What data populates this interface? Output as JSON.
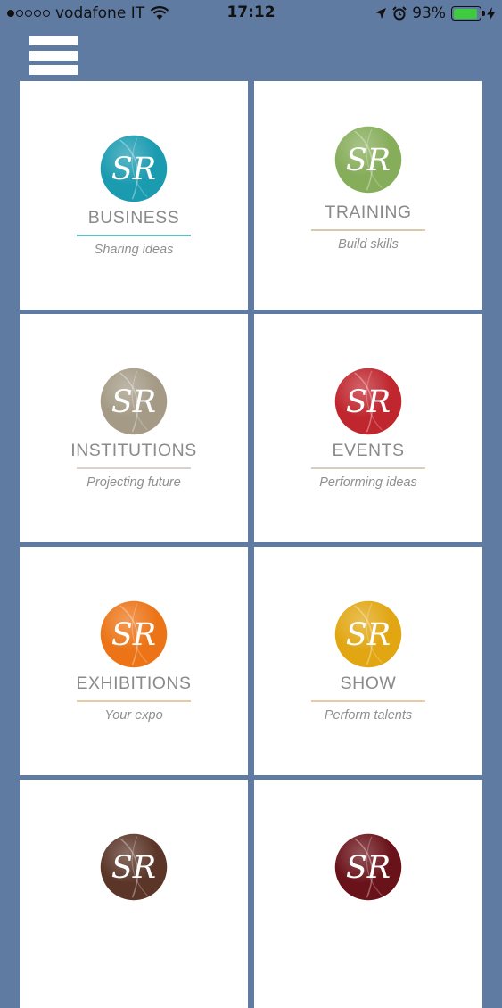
{
  "status": {
    "carrier": "vodafone IT",
    "time": "17:12",
    "battery": "93%",
    "battery_level": 0.93
  },
  "tiles": [
    {
      "title": "BUSINESS",
      "subtitle": "Sharing ideas",
      "color": "#1a9bb0",
      "line": "#62bcc8",
      "logo": "SR"
    },
    {
      "title": "TRAINING",
      "subtitle": "Build skills",
      "color": "#86ad5a",
      "line": "#d8c8ae",
      "logo": "SR"
    },
    {
      "title": "INSTITUTIONS",
      "subtitle": "Projecting future",
      "color": "#a49a85",
      "line": "#d8d2c8",
      "logo": "SR"
    },
    {
      "title": "EVENTS",
      "subtitle": "Performing ideas",
      "color": "#c0262e",
      "line": "#d6cdbd",
      "logo": "SR"
    },
    {
      "title": "EXHIBITIONS",
      "subtitle": "Your expo",
      "color": "#ec7416",
      "line": "#e6c9a6",
      "logo": "SR"
    },
    {
      "title": "SHOW",
      "subtitle": "Perform talents",
      "color": "#e1a612",
      "line": "#e6c9a6",
      "logo": "SR"
    },
    {
      "title": "",
      "subtitle": "",
      "color": "#5b3528",
      "line": "#ffffff",
      "logo": "SR"
    },
    {
      "title": "",
      "subtitle": "",
      "color": "#6a1219",
      "line": "#ffffff",
      "logo": "SR"
    }
  ]
}
